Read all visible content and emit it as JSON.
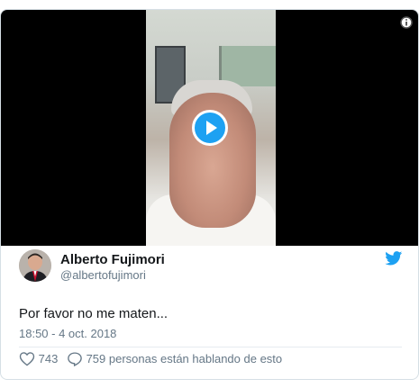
{
  "tweet": {
    "author_name": "Alberto Fujimori",
    "author_handle": "@albertofujimori",
    "text": "Por favor no me maten...",
    "timestamp": "18:50 - 4 oct. 2018",
    "likes": "743",
    "conversation": "759 personas están hablando de esto"
  },
  "icons": {
    "play": "play-icon",
    "info": "info-icon",
    "brand": "twitter-bird-icon",
    "like": "heart-icon",
    "reply": "speech-bubble-icon"
  },
  "colors": {
    "accent": "#1da1f2",
    "text": "#14171a",
    "muted": "#657786",
    "media_background": "#000000"
  }
}
